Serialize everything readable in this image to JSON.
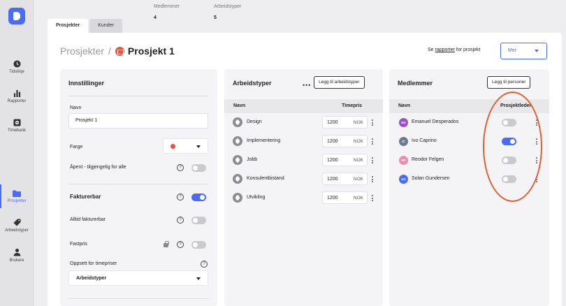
{
  "sidebar": {
    "items": [
      {
        "label": "Tidslinje",
        "icon": "clock-icon"
      },
      {
        "label": "Rapporter",
        "icon": "bar-chart-icon"
      },
      {
        "label": "Timebank",
        "icon": "timebank-icon"
      },
      {
        "label": "Prosjekter",
        "icon": "folder-icon",
        "active": true
      },
      {
        "label": "Arbeidstyper",
        "icon": "tag-icon"
      },
      {
        "label": "Brukere",
        "icon": "user-icon"
      }
    ]
  },
  "tabs": [
    {
      "label": "Prosjekter",
      "active": true
    },
    {
      "label": "Kunder",
      "active": false
    }
  ],
  "stats": [
    {
      "label": "Medlemmer",
      "value": "4"
    },
    {
      "label": "Arbeidstyper",
      "value": "5"
    }
  ],
  "header": {
    "breadcrumb_parent": "Prosjekter",
    "breadcrumb_sep": "/",
    "project_name": "Prosjekt 1",
    "report_prefix": "Se",
    "report_link": "rapporter",
    "report_suffix": "for prosjekt",
    "more_button": "Mer"
  },
  "settings": {
    "title": "Innstillinger",
    "name_label": "Navn",
    "name_value": "Prosjekt 1",
    "color_label": "Farge",
    "color_value": "#e8533a",
    "open_label": "Åpent - tilgjengelig for alle",
    "open_on": false,
    "billable_label": "Fakturerbar",
    "billable_on": true,
    "always_billable_label": "Alltid fakturerbar",
    "always_billable_on": false,
    "fixed_price_label": "Fastpris",
    "fixed_price_on": false,
    "rate_setup_label": "Oppsett for timepriser",
    "rate_setup_value": "Arbeidstyper",
    "help_glyph": "?"
  },
  "worktypes": {
    "title": "Arbeidstyper",
    "more_glyph": "•••",
    "add_button": "Legg til arbeidstyper",
    "col_name": "Navn",
    "col_rate": "Timepris",
    "rows": [
      {
        "name": "Design",
        "rate": "1200",
        "currency": "NOK"
      },
      {
        "name": "Implementering",
        "rate": "1200",
        "currency": "NOK"
      },
      {
        "name": "Jobb",
        "rate": "1200",
        "currency": "NOK"
      },
      {
        "name": "Konsulentbistand",
        "rate": "1200",
        "currency": "NOK"
      },
      {
        "name": "Utvikling",
        "rate": "1200",
        "currency": "NOK"
      }
    ]
  },
  "members": {
    "title": "Medlemmer",
    "add_button": "Legg til personer",
    "col_name": "Navn",
    "col_lead": "Prosjektleder",
    "rows": [
      {
        "initials": "ED",
        "name": "Emanuel Desperados",
        "color": "#9b4fc9",
        "lead": false
      },
      {
        "initials": "IC",
        "name": "Ivo Caprino",
        "color": "#6b7a8c",
        "lead": true
      },
      {
        "initials": "RF",
        "name": "Reodor Felgen",
        "color": "#f08bb0",
        "lead": false
      },
      {
        "initials": "SG",
        "name": "Solan Gundersen",
        "color": "#4b6cf2",
        "lead": false
      }
    ]
  }
}
